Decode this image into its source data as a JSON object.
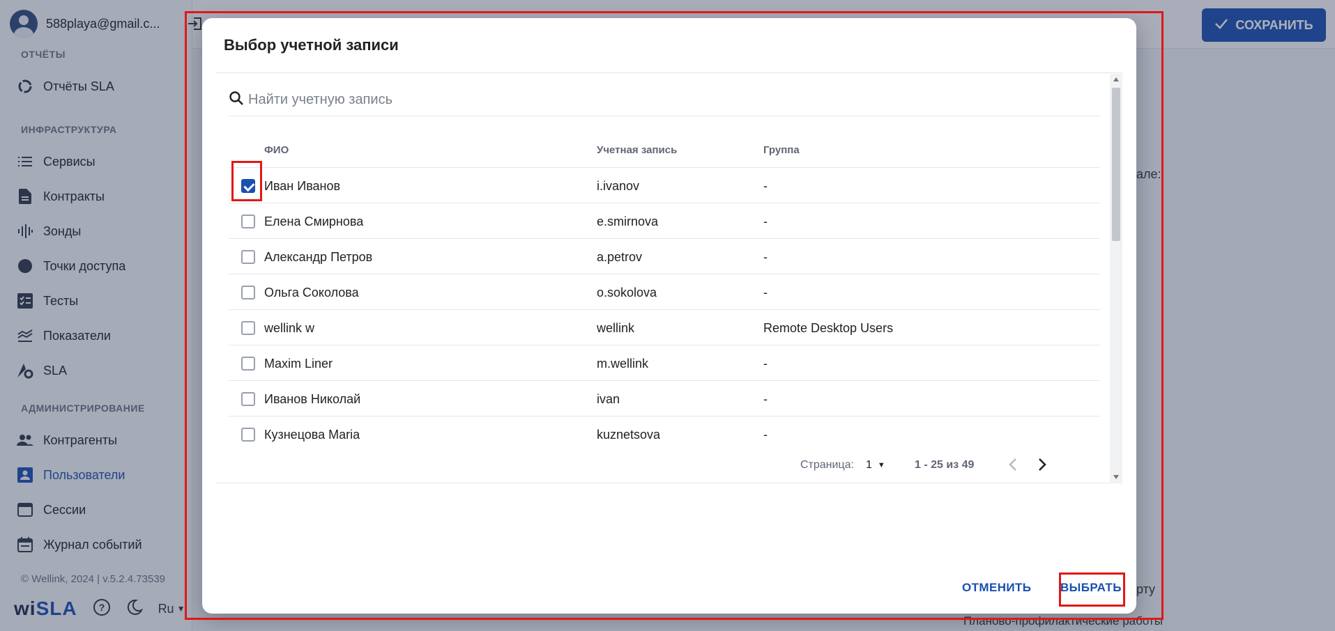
{
  "user": {
    "email": "588playa@gmail.c..."
  },
  "sidebar": {
    "sections": {
      "reports": "ОТЧЁТЫ",
      "infrastructure": "ИНФРАСТРУКТУРА",
      "administration": "АДМИНИСТРИРОВАНИЕ"
    },
    "items": [
      {
        "label": "Отчёты SLA",
        "icon": "donut-chart-icon"
      },
      {
        "label": "Сервисы",
        "icon": "list-icon"
      },
      {
        "label": "Контракты",
        "icon": "document-icon"
      },
      {
        "label": "Зонды",
        "icon": "waveform-icon"
      },
      {
        "label": "Точки доступа",
        "icon": "circle-icon"
      },
      {
        "label": "Тесты",
        "icon": "checklist-icon"
      },
      {
        "label": "Показатели",
        "icon": "stacked-lines-icon"
      },
      {
        "label": "SLA",
        "icon": "sla-gear-icon"
      },
      {
        "label": "Контрагенты",
        "icon": "people-icon"
      },
      {
        "label": "Пользователи",
        "icon": "user-card-icon",
        "active": true
      },
      {
        "label": "Сессии",
        "icon": "browser-window-icon"
      },
      {
        "label": "Журнал событий",
        "icon": "calendar-icon"
      }
    ],
    "copyright": "© Wellink, 2024 | v.5.2.4.73539",
    "logo_prefix": "wi",
    "logo_suffix": "SLA",
    "language": "Ru"
  },
  "header": {
    "save_label": "СОХРАНИТЬ"
  },
  "background_text": {
    "fragment1": "але:",
    "fragment2": "рту",
    "fragment3": "Планово-профилактические работы"
  },
  "modal": {
    "title": "Выбор учетной записи",
    "search_placeholder": "Найти учетную запись",
    "columns": {
      "name": "ФИО",
      "account": "Учетная запись",
      "group": "Группа"
    },
    "rows": [
      {
        "name": "Иван Иванов",
        "account": "i.ivanov",
        "group": "-",
        "checked": true
      },
      {
        "name": "Елена Смирнова",
        "account": "e.smirnova",
        "group": "-",
        "checked": false
      },
      {
        "name": "Александр Петров",
        "account": "a.petrov",
        "group": "-",
        "checked": false
      },
      {
        "name": "Ольга Соколова",
        "account": "o.sokolova",
        "group": "-",
        "checked": false
      },
      {
        "name": "wellink w",
        "account": "wellink",
        "group": "Remote Desktop Users",
        "checked": false
      },
      {
        "name": "Maxim Liner",
        "account": "m.wellink",
        "group": "-",
        "checked": false
      },
      {
        "name": "Иванов Николай",
        "account": "ivan",
        "group": "-",
        "checked": false
      },
      {
        "name": "Кузнецова Maria",
        "account": "kuznetsova",
        "group": "-",
        "checked": false
      }
    ],
    "pager": {
      "page_label": "Страница:",
      "page": "1",
      "range": "1 - 25 из 49"
    },
    "cancel_label": "ОТМЕНИТЬ",
    "select_label": "ВЫБРАТЬ"
  }
}
